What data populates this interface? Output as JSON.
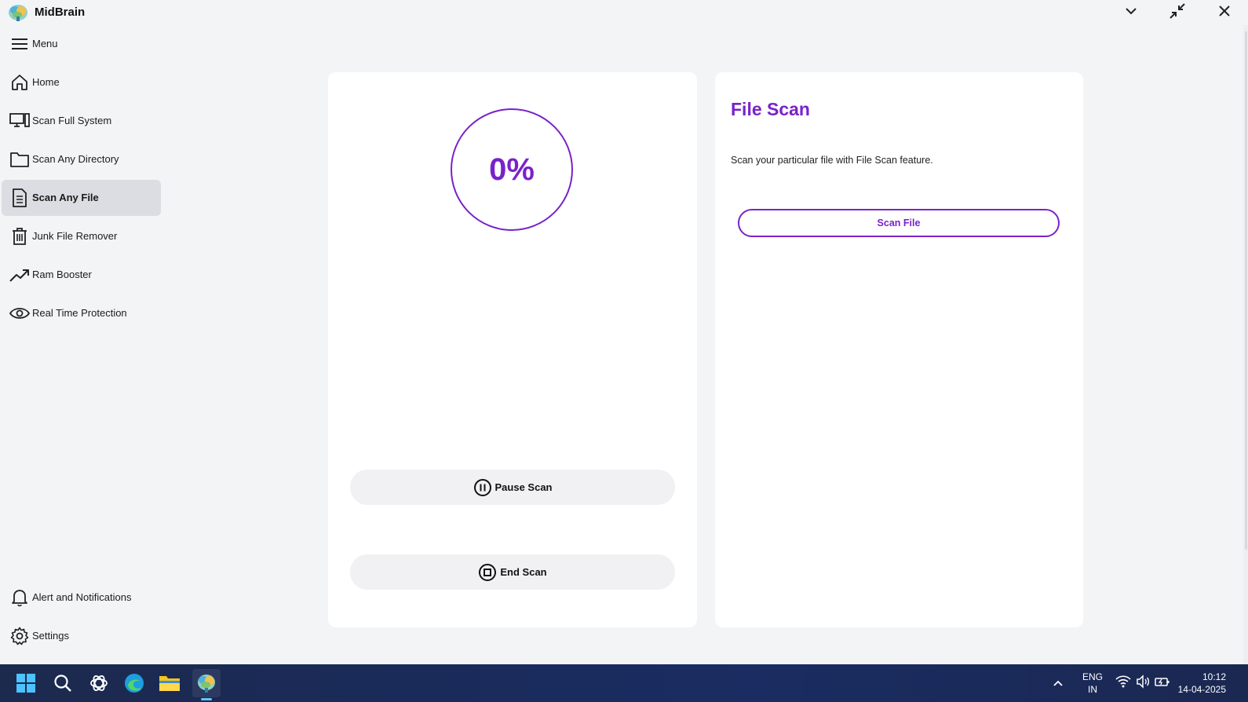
{
  "app": {
    "title": "MidBrain",
    "logo_icon": "brain-logo-icon"
  },
  "window_controls": {
    "collapse_icon": "chevron-down-icon",
    "restore_icon": "minimize-arrows-icon",
    "close_icon": "close-icon"
  },
  "sidebar": {
    "items": [
      {
        "label": "Menu",
        "icon": "hamburger-icon"
      },
      {
        "label": "Home",
        "icon": "home-icon"
      },
      {
        "label": "Scan Full System",
        "icon": "computer-icon"
      },
      {
        "label": "Scan Any Directory",
        "icon": "folder-icon"
      },
      {
        "label": "Scan Any File",
        "icon": "file-icon",
        "active": true
      },
      {
        "label": "Junk File Remover",
        "icon": "trash-icon"
      },
      {
        "label": "Ram Booster",
        "icon": "trend-up-icon"
      },
      {
        "label": "Real Time Protection",
        "icon": "eye-icon"
      },
      {
        "label": "Alert and Notifications",
        "icon": "bell-icon"
      },
      {
        "label": "Settings",
        "icon": "gear-icon"
      }
    ]
  },
  "scan_panel": {
    "progress_text": "0%",
    "progress_value": 0,
    "pause_label": "Pause Scan",
    "end_label": "End Scan"
  },
  "file_scan": {
    "title": "File Scan",
    "description": "Scan your particular file with File Scan feature.",
    "button_label": "Scan File"
  },
  "taskbar": {
    "icons": [
      "windows-start-icon",
      "search-icon",
      "chatgpt-icon",
      "edge-icon",
      "file-explorer-icon",
      "midbrain-icon"
    ],
    "language_line1": "ENG",
    "language_line2": "IN",
    "time": "10:12",
    "date": "14-04-2025"
  },
  "colors": {
    "accent": "#7a22c9",
    "background": "#f3f4f6",
    "card": "#ffffff",
    "active_nav": "#dcdde2",
    "taskbar": "#1a2b5c"
  }
}
